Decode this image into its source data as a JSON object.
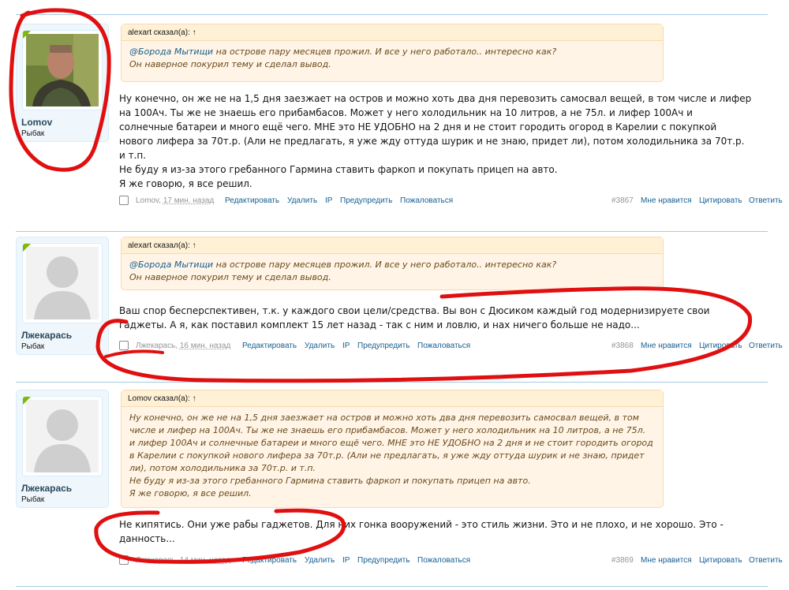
{
  "posts": [
    {
      "user": {
        "name": "Lomov",
        "title": "Рыбак",
        "avatar": "user-photo"
      },
      "quote": {
        "header": "alexart сказал(а): ↑",
        "mention": "@Борода Мытищи",
        "line1": " на острове пару месяцев прожил. И все у него работало.. интересно как?",
        "line2": "Он наверное покурил тему и сделал вывод."
      },
      "message": [
        "Ну конечно, он же не на 1,5 дня заезжает на остров и можно хоть два дня перевозить самосвал вещей, в том числе и лифер",
        "на 100Ач. Ты же не знаешь его прибамбасов. Может у него холодильник на 10 литров, а не 75л. и лифер 100Ач и",
        "солнечные батареи и много ещё чего. МНЕ это НЕ УДОБНО на 2 дня и не стоит городить огород в Карелии с покупкой",
        "нового лифера за 70т.р. (Али не предлагать, я уже жду оттуда шурик и не знаю, придет ли), потом холодильника за 70т.р.",
        "и т.п.",
        "Не буду я из-за этого гребанного Гармина ставить фаркоп и покупать прицеп на авто.",
        "Я же говорю, я все решил."
      ],
      "meta": {
        "author": "Lomov",
        "time": "17 мин. назад",
        "edit": "Редактировать",
        "delete": "Удалить",
        "ip": "IP",
        "warn": "Предупредить",
        "report": "Пожаловаться",
        "number": "#3867",
        "like": "Мне нравится",
        "quote": "Цитировать",
        "reply": "Ответить"
      }
    },
    {
      "user": {
        "name": "Лжекарась",
        "title": "Рыбак",
        "avatar": "default-avatar"
      },
      "quote": {
        "header": "alexart сказал(а): ↑",
        "mention": "@Борода Мытищи",
        "line1": " на острове пару месяцев прожил. И все у него работало.. интересно как?",
        "line2": "Он наверное покурил тему и сделал вывод."
      },
      "message": [
        "Ваш спор бесперспективен, т.к. у каждого свои цели/средства. Вы вон с Дюсиком каждый год модернизируете свои",
        "гаджеты. А я, как поставил комплект 15 лет назад - так с ним и ловлю, и нах ничего больше не надо..."
      ],
      "meta": {
        "author": "Лжекарась",
        "time": "16 мин. назад",
        "edit": "Редактировать",
        "delete": "Удалить",
        "ip": "IP",
        "warn": "Предупредить",
        "report": "Пожаловаться",
        "number": "#3868",
        "like": "Мне нравится",
        "quote": "Цитировать",
        "reply": "Ответить"
      }
    },
    {
      "user": {
        "name": "Лжекарась",
        "title": "Рыбак",
        "avatar": "default-avatar"
      },
      "quote": {
        "header": "Lomov сказал(а): ↑",
        "lines": [
          "Ну конечно, он же не на 1,5 дня заезжает на остров и можно хоть два дня перевозить самосвал вещей, в том",
          "числе и лифер на 100Ач. Ты же не знаешь его прибамбасов. Может у него холодильник на 10 литров, а не 75л.",
          "и лифер 100Ач и солнечные батареи и много ещё чего. МНЕ это НЕ УДОБНО на 2 дня и не стоит городить огород",
          "в Карелии с покупкой нового лифера за 70т.р. (Али не предлагать, я уже жду оттуда шурик и не знаю, придет",
          "ли), потом холодильника за 70т.р. и т.п.",
          "Не буду я из-за этого гребанного Гармина ставить фаркоп и покупать прицеп на авто.",
          "Я же говорю, я все решил."
        ]
      },
      "message": [
        "Не кипятись. Они уже рабы гаджетов. Для них гонка вооружений - это стиль жизни. Это и не плохо, и не хорошо. Это -",
        "данность..."
      ],
      "meta": {
        "author": "Лжекарась",
        "time": "14 мин. назад",
        "edit": "Редактировать",
        "delete": "Удалить",
        "ip": "IP",
        "warn": "Предупредить",
        "report": "Пожаловаться",
        "number": "#3869",
        "like": "Мне нравится",
        "quote": "Цитировать",
        "reply": "Ответить"
      }
    }
  ],
  "colors": {
    "link": "#176093",
    "annotation": "#e01010",
    "quote_bg": "#fff4e5",
    "user_bg": "#f0f7fc",
    "online": "#7fb900"
  }
}
